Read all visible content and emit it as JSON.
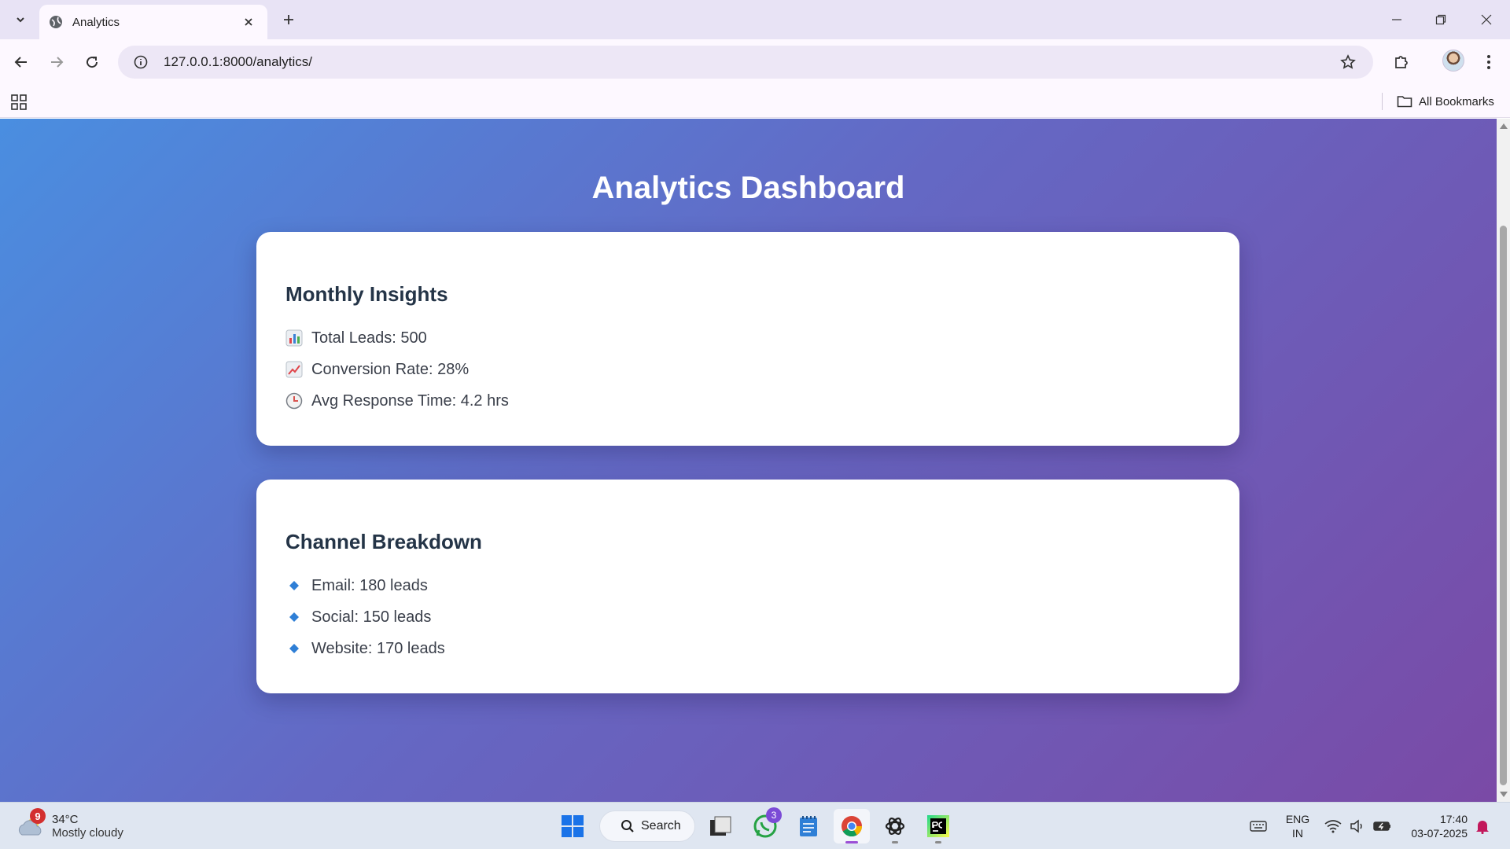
{
  "browser": {
    "tab_title": "Analytics",
    "url": "127.0.0.1:8000/analytics/",
    "bookmarks_label": "All Bookmarks"
  },
  "page": {
    "title": "Analytics Dashboard",
    "cards": [
      {
        "title": "Monthly Insights",
        "items": [
          {
            "icon": "bar-chart-icon",
            "text": "Total Leads: 500"
          },
          {
            "icon": "trend-up-icon",
            "text": "Conversion Rate: 28%"
          },
          {
            "icon": "clock-icon",
            "text": "Avg Response Time: 4.2 hrs"
          }
        ]
      },
      {
        "title": "Channel Breakdown",
        "items": [
          {
            "icon": "blue-diamond-icon",
            "text": "Email: 180 leads"
          },
          {
            "icon": "blue-diamond-icon",
            "text": "Social: 150 leads"
          },
          {
            "icon": "blue-diamond-icon",
            "text": "Website: 170 leads"
          }
        ]
      }
    ]
  },
  "taskbar": {
    "weather_temp": "34°C",
    "weather_desc": "Mostly cloudy",
    "weather_badge": "9",
    "search_label": "Search",
    "whatsapp_badge": "3",
    "lang_top": "ENG",
    "lang_bottom": "IN",
    "time": "17:40",
    "date": "03-07-2025"
  },
  "colors": {
    "gradient_start": "#4a8ee0",
    "gradient_end": "#7a4aa6",
    "card_bg": "#ffffff",
    "heading": "#243447"
  }
}
